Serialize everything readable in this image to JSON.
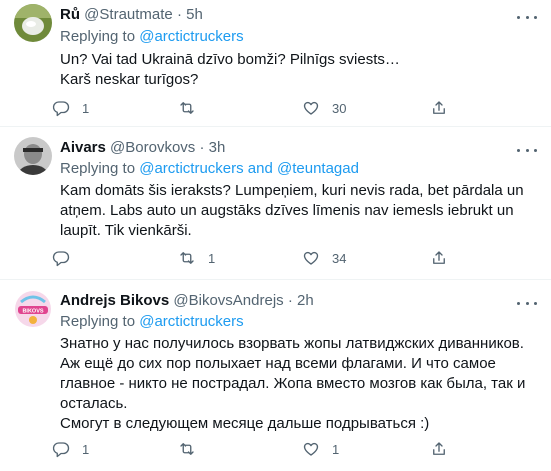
{
  "tweets": [
    {
      "name": "Rů",
      "handle": "@Strautmate",
      "sep": "·",
      "time": "5h",
      "replying_prefix": "Replying to",
      "replying_to": "@arctictruckers",
      "text": "Un? Vai tad Ukrainā dzīvo bomži? Pilnīgs sviests…\nKarš neskar turīgos?",
      "replies": "1",
      "retweets": "",
      "likes": "30"
    },
    {
      "name": "Aivars",
      "handle": "@Borovkovs",
      "sep": "·",
      "time": "3h",
      "replying_prefix": "Replying to",
      "replying_to": "@arctictruckers and @teuntagad",
      "text": "Kam domāts šis ieraksts? Lumpeņiem, kuri nevis rada, bet pārdala un atņem. Labs auto un augstāks dzīves līmenis nav iemesls iebrukt un laupīt. Tik vienkārši.",
      "replies": "",
      "retweets": "1",
      "likes": "34"
    },
    {
      "name": "Andrejs Bikovs",
      "handle": "@BikovsAndrejs",
      "sep": "·",
      "time": "2h",
      "avatar_text": "BIKOVS",
      "replying_prefix": "Replying to",
      "replying_to": "@arctictruckers",
      "text": "Знатно у нас получилось взорвать жопы латвиджских диванников.\nАж ещё до сих пор полыхает над всеми флагами. И что самое главное - никто не пострадал. Жопа вместо мозгов как была, так и осталась.\nСмогут в следующем месяце дальше подрываться :)",
      "replies": "1",
      "retweets": "",
      "likes": "1"
    }
  ],
  "icons": [
    "reply-icon",
    "retweet-icon",
    "like-icon",
    "share-icon",
    "more-icon"
  ],
  "colors": {
    "link": "#1d9bf0",
    "secondary": "#536471",
    "text": "#0f1419",
    "divider": "#eff3f4"
  }
}
